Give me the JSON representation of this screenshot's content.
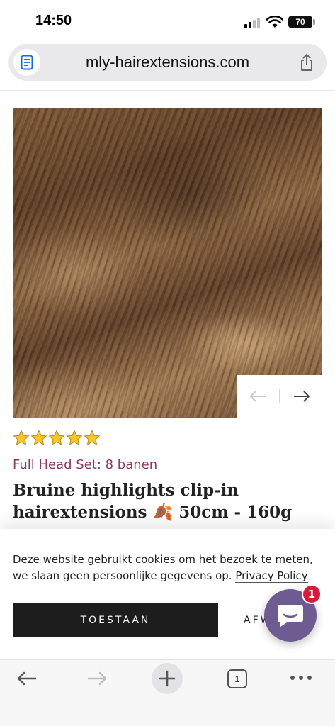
{
  "status_bar": {
    "time": "14:50",
    "battery": "70"
  },
  "browser": {
    "url": "mly-hairextensions.com"
  },
  "product": {
    "rating_stars": 5,
    "variant": "Full Head Set: 8 banen",
    "title_prefix": "Bruine highlights clip-in hairextensions",
    "title_emoji": "🍂",
    "title_suffix": "50cm - 160g"
  },
  "cookie_banner": {
    "text": "Deze website gebruikt cookies om het bezoek te meten, we slaan geen persoonlijke gegevens op.",
    "link_label": "Privacy Policy",
    "accept_label": "TOESTAAN",
    "decline_label": "AFWIJZEN"
  },
  "chat": {
    "badge_count": "1"
  },
  "toolbar": {
    "tab_count": "1"
  },
  "colors": {
    "accent_variant": "#8a3a62",
    "chat": "#6e5b92",
    "badge": "#d81b3a",
    "button_dark": "#1d1d1d"
  }
}
